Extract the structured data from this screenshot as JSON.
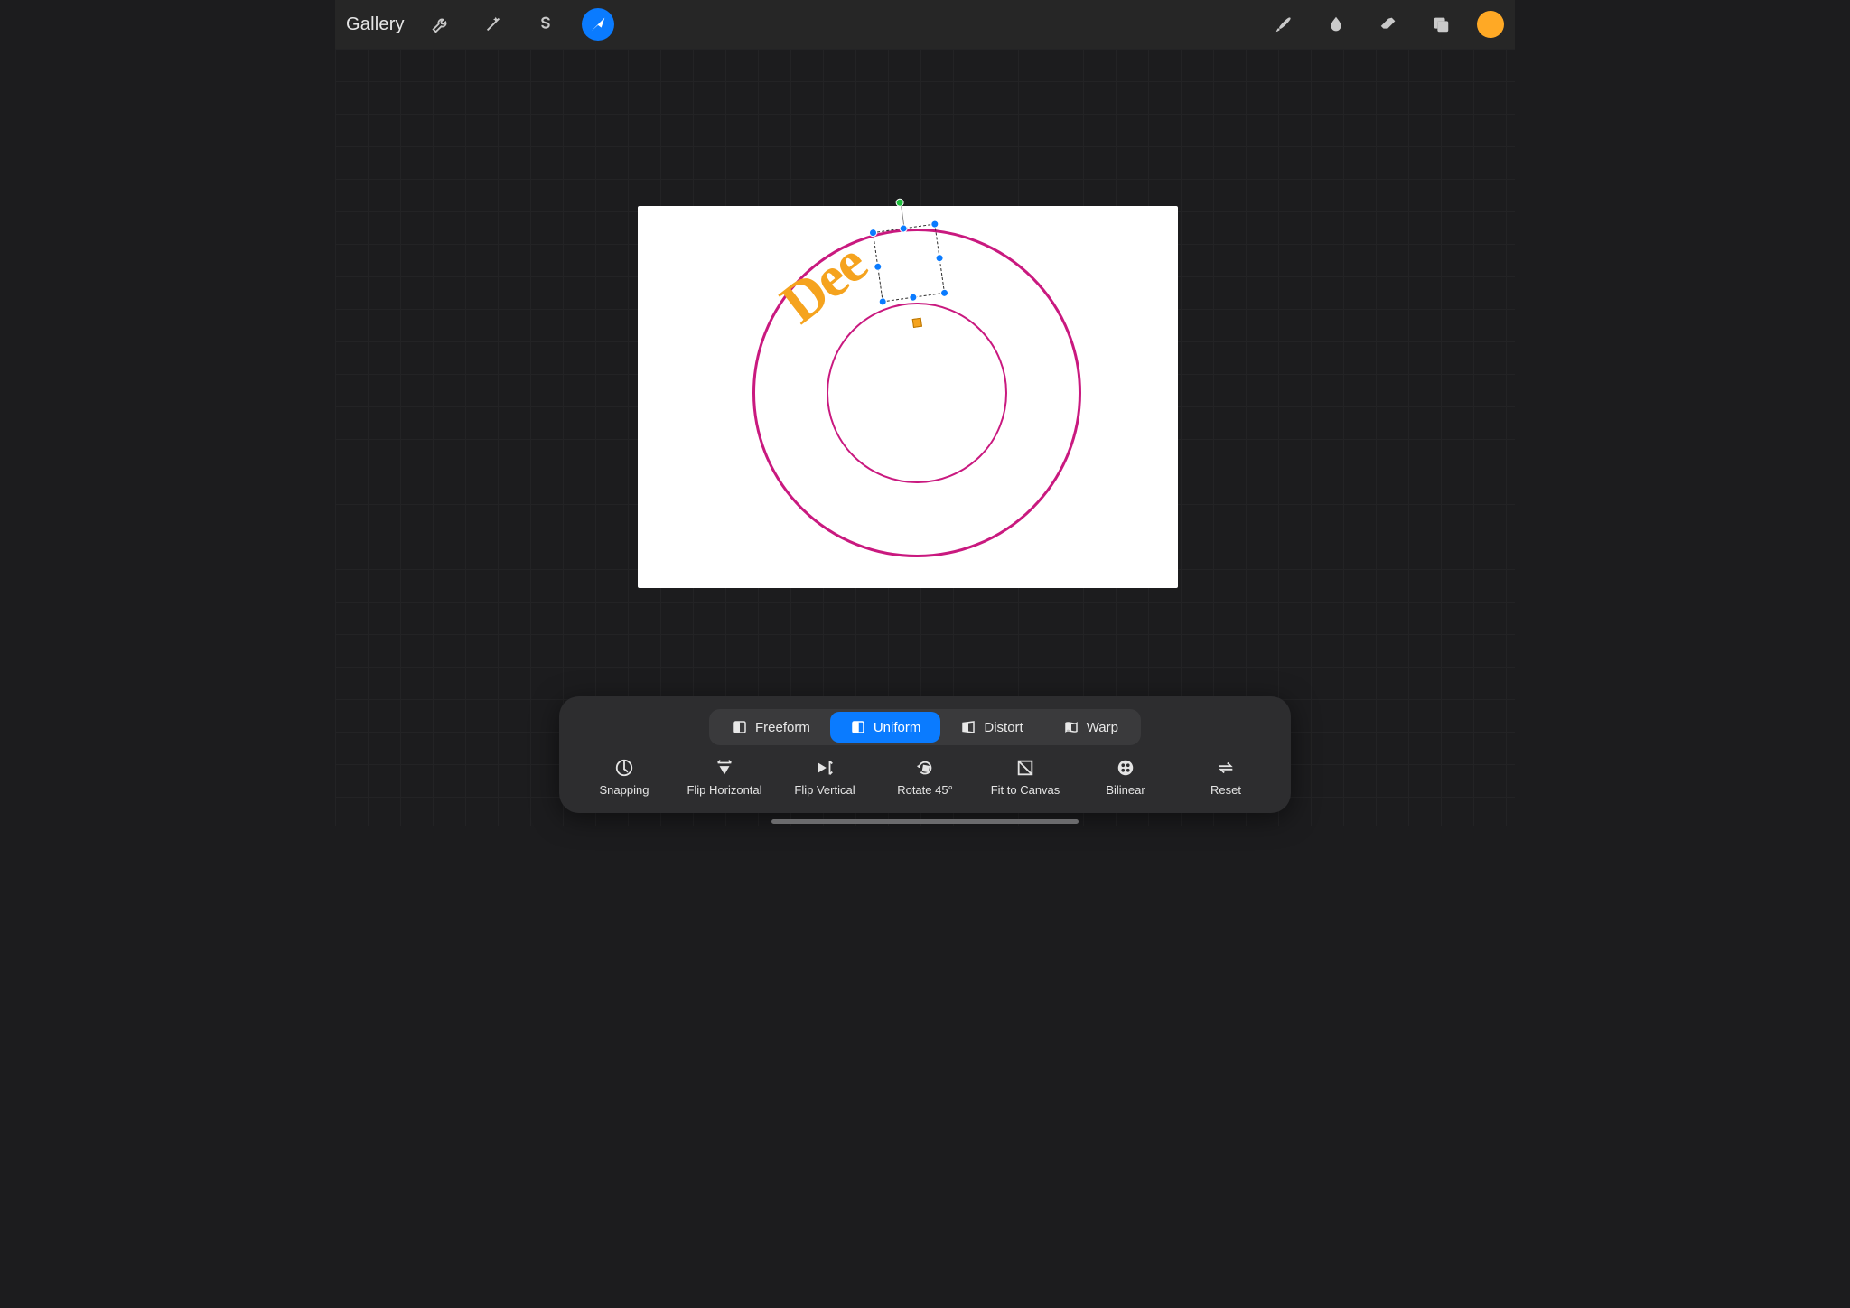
{
  "topbar": {
    "gallery_label": "Gallery",
    "swatch_color": "#ffa925"
  },
  "canvas": {
    "text_content": "Dee",
    "text_color": "#f5a31e",
    "ring_color": "#c9197f"
  },
  "modes": [
    {
      "id": "freeform",
      "label": "Freeform",
      "active": false
    },
    {
      "id": "uniform",
      "label": "Uniform",
      "active": true
    },
    {
      "id": "distort",
      "label": "Distort",
      "active": false
    },
    {
      "id": "warp",
      "label": "Warp",
      "active": false
    }
  ],
  "actions": [
    {
      "id": "snapping",
      "label": "Snapping"
    },
    {
      "id": "flip_h",
      "label": "Flip Horizontal"
    },
    {
      "id": "flip_v",
      "label": "Flip Vertical"
    },
    {
      "id": "rotate45",
      "label": "Rotate 45°"
    },
    {
      "id": "fit",
      "label": "Fit to Canvas"
    },
    {
      "id": "bilinear",
      "label": "Bilinear"
    },
    {
      "id": "reset",
      "label": "Reset"
    }
  ]
}
